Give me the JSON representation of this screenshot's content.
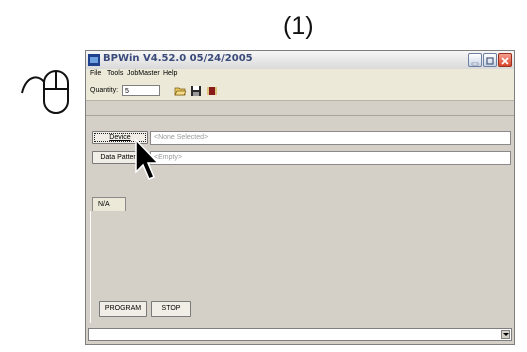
{
  "step": {
    "label": "(1)"
  },
  "window": {
    "title": "BPWin  V4.52.0  05/24/2005",
    "buttons": [
      "minimize",
      "maximize",
      "close"
    ]
  },
  "menu": {
    "items": [
      "File",
      "Tools",
      "JobMaster",
      "Help"
    ]
  },
  "toolbar": {
    "quantity_label": "Quantity:",
    "quantity_value": "5",
    "icons": [
      "open-folder-icon",
      "save-disk-icon",
      "program-chip-icon"
    ]
  },
  "main": {
    "device_button": "Device",
    "device_value": "<None Selected>",
    "data_pattern_button": "Data Pattern",
    "data_pattern_value": "<Empty>",
    "tab_label": "N/A",
    "program_button": "PROGRAM",
    "stop_button": "STOP"
  },
  "colors": {
    "title_text": "#3a4a7a",
    "close_button": "#d9432a",
    "window_face": "#d4d0c8"
  }
}
